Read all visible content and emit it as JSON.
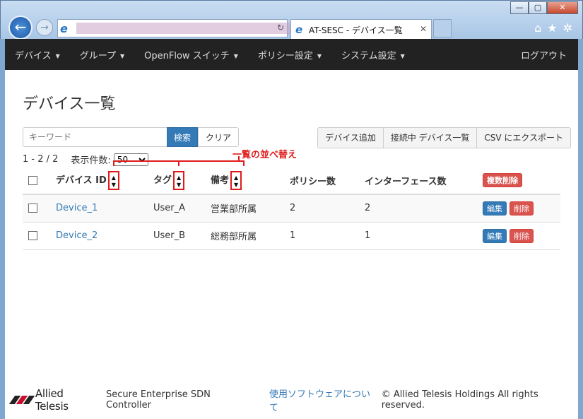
{
  "browser": {
    "tab_title": "AT-SESC - デバイス一覧",
    "tab_close": "✕",
    "window_buttons": [
      "—",
      "▢",
      "✕"
    ],
    "icons": [
      "home-icon",
      "star-icon",
      "gear-icon"
    ]
  },
  "navbar": {
    "items": [
      {
        "label": "デバイス"
      },
      {
        "label": "グループ"
      },
      {
        "label": "OpenFlow スイッチ"
      },
      {
        "label": "ポリシー設定"
      },
      {
        "label": "システム設定"
      }
    ],
    "logout": "ログアウト"
  },
  "page": {
    "title": "デバイス一覧"
  },
  "search": {
    "placeholder": "キーワード",
    "search_button": "検索",
    "clear_button": "クリア"
  },
  "actions": {
    "add_device": "デバイス追加",
    "connected_devices": "接続中 デバイス一覧",
    "export_csv": "CSV にエクスポート"
  },
  "pager": {
    "range": "1 - 2 / 2",
    "per_page_label": "表示件数:",
    "per_page_value": "50"
  },
  "annotation": {
    "text": "一覧の並べ替え"
  },
  "table": {
    "headers": {
      "device_id": "デバイス ID",
      "tag": "タグ",
      "note": "備考",
      "policy_count": "ポリシー数",
      "interface_count": "インターフェース数",
      "bulk_delete": "複数削除"
    },
    "rows": [
      {
        "device_id": "Device_1",
        "tag": "User_A",
        "note": "営業部所属",
        "policy_count": "2",
        "interface_count": "2",
        "edit": "編集",
        "delete": "削除"
      },
      {
        "device_id": "Device_2",
        "tag": "User_B",
        "note": "総務部所属",
        "policy_count": "1",
        "interface_count": "1",
        "edit": "編集",
        "delete": "削除"
      }
    ]
  },
  "footer": {
    "brand": "Allied Telesis",
    "product": "Secure Enterprise SDN Controller",
    "about_link": "使用ソフトウェアについて",
    "copyright": "© Allied Telesis Holdings All rights reserved."
  }
}
